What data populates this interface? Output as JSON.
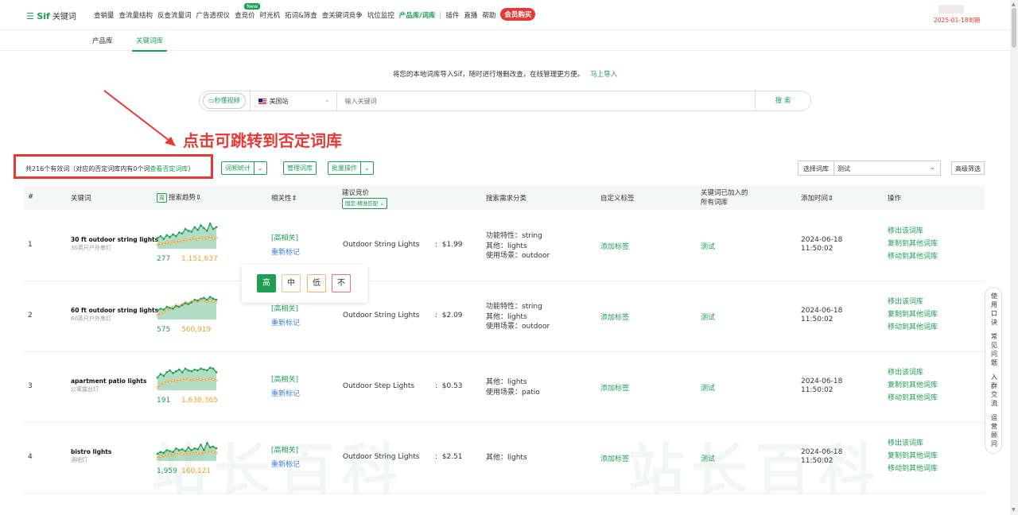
{
  "app": {
    "logo_brand": "Sif",
    "logo_product": "关键词",
    "expire": "2025-01-18到期"
  },
  "nav": [
    {
      "label": "查销量"
    },
    {
      "label": "查流量结构"
    },
    {
      "label": "反查流量词"
    },
    {
      "label": "广告透视仪"
    },
    {
      "label": "查竞价",
      "badge": "New"
    },
    {
      "label": "时光机"
    },
    {
      "label": "拓词&筛查"
    },
    {
      "label": "查关键词竞争"
    },
    {
      "label": "坑位监控"
    },
    {
      "label": "产品库/词库",
      "active": true
    },
    {
      "label": "插件"
    },
    {
      "label": "直播"
    },
    {
      "label": "帮助"
    },
    {
      "label": "会员购买",
      "button": true
    }
  ],
  "subtabs": {
    "product_lib": "产品库",
    "keyword_lib": "关键词库"
  },
  "import": {
    "text": "将您的本地词库导入Sif，随时进行增删改查，在线管理更方便。",
    "link": "马上导入"
  },
  "search": {
    "video_btn": "秒懂视频",
    "country": "美国站",
    "placeholder": "输入关键词",
    "button": "搜 索"
  },
  "annotation": "点击可跳转到否定词库",
  "toolbar": {
    "count_text": "共216个有效词（对应的否定词库内有0个词",
    "count_link": "查看否定词库",
    "count_close": "）",
    "btn_word_freq": "词频统计",
    "btn_manage": "管理词库",
    "btn_batch": "批量操作",
    "select_label": "选择词库",
    "select_value": "测试",
    "adv_filter": "高级筛选"
  },
  "table": {
    "headers": {
      "index": "#",
      "keyword": "关键词",
      "trend_toggle": "周",
      "trend": "搜索趋势",
      "relevance": "相关性",
      "bid": "建议竞价",
      "bid_select": "固定-精准匹配",
      "demand": "搜索需求分类",
      "tag": "自定义标签",
      "libs_line1": "关键词已加入的",
      "libs_line2": "所有词库",
      "time": "添加时间",
      "ops": "操作"
    },
    "rows": [
      {
        "index": "1",
        "kw": "30 ft outdoor string lights",
        "kw_cn": "30英尺户外串灯",
        "num1": "277",
        "num2": "1,151,637",
        "relevance": "[高相关]",
        "remark": "重新标记",
        "bid_kw": "Outdoor String Lights",
        "bid": "$1.99",
        "demand": [
          "功能特性：string",
          "其他：lights",
          "使用场景：outdoor"
        ],
        "tag": "添加标签",
        "lib": "测试",
        "date": "2024-06-18",
        "time": "11:50:02",
        "ops": [
          "移出该词库",
          "复制到其他词库",
          "移动到其他词库"
        ]
      },
      {
        "index": "2",
        "kw": "60 ft outdoor string lights",
        "kw_cn": "60英尺户外串灯",
        "num1": "575",
        "num2": "560,919",
        "relevance": "[高相关]",
        "remark": "重新标记",
        "bid_kw": "Outdoor String Lights",
        "bid": "$2.09",
        "demand": [
          "功能特性：string",
          "其他：lights",
          "使用场景：outdoor"
        ],
        "tag": "添加标签",
        "lib": "测试",
        "date": "2024-06-18",
        "time": "11:50:02",
        "ops": [
          "移出该词库",
          "复制到其他词库",
          "移动到其他词库"
        ]
      },
      {
        "index": "3",
        "kw": "apartment patio lights",
        "kw_cn": "公寓露台灯",
        "num1": "191",
        "num2": "1,638,365",
        "relevance": "[高相关]",
        "remark": "重新标记",
        "bid_kw": "Outdoor Step Lights",
        "bid": "$0.53",
        "demand": [
          "其他：lights",
          "使用场景：patio"
        ],
        "tag": "添加标签",
        "lib": "测试",
        "date": "2024-06-18",
        "time": "11:50:02",
        "ops": [
          "移出该词库",
          "复制到其他词库",
          "移动到其他词库"
        ]
      },
      {
        "index": "4",
        "kw": "bistro lights",
        "kw_cn": "酒吧灯",
        "num1": "1,959",
        "num2": "160,121",
        "relevance": "[高相关]",
        "remark": "重新标记",
        "bid_kw": "Outdoor String Lights",
        "bid": "$2.51",
        "demand": [
          "其他：lights"
        ],
        "tag": "添加标签",
        "lib": "测试",
        "date": "2024-06-18",
        "time": "11:50:02",
        "ops": [
          "移出该词库",
          "复制到其他词库",
          "移动到其他词库"
        ]
      }
    ]
  },
  "popover": {
    "high": "高",
    "mid": "中",
    "low": "低",
    "no": "不"
  },
  "side_float": {
    "item1": "使用口诀",
    "item2": "常见问题",
    "item3": "入群交流",
    "item4": "运营顾问"
  },
  "watermark": "站长百科",
  "colors": {
    "brand": "#1f9d55",
    "accent_red": "#e53935",
    "link_blue": "#3b7ddd",
    "trend_orange": "#f0a030"
  }
}
